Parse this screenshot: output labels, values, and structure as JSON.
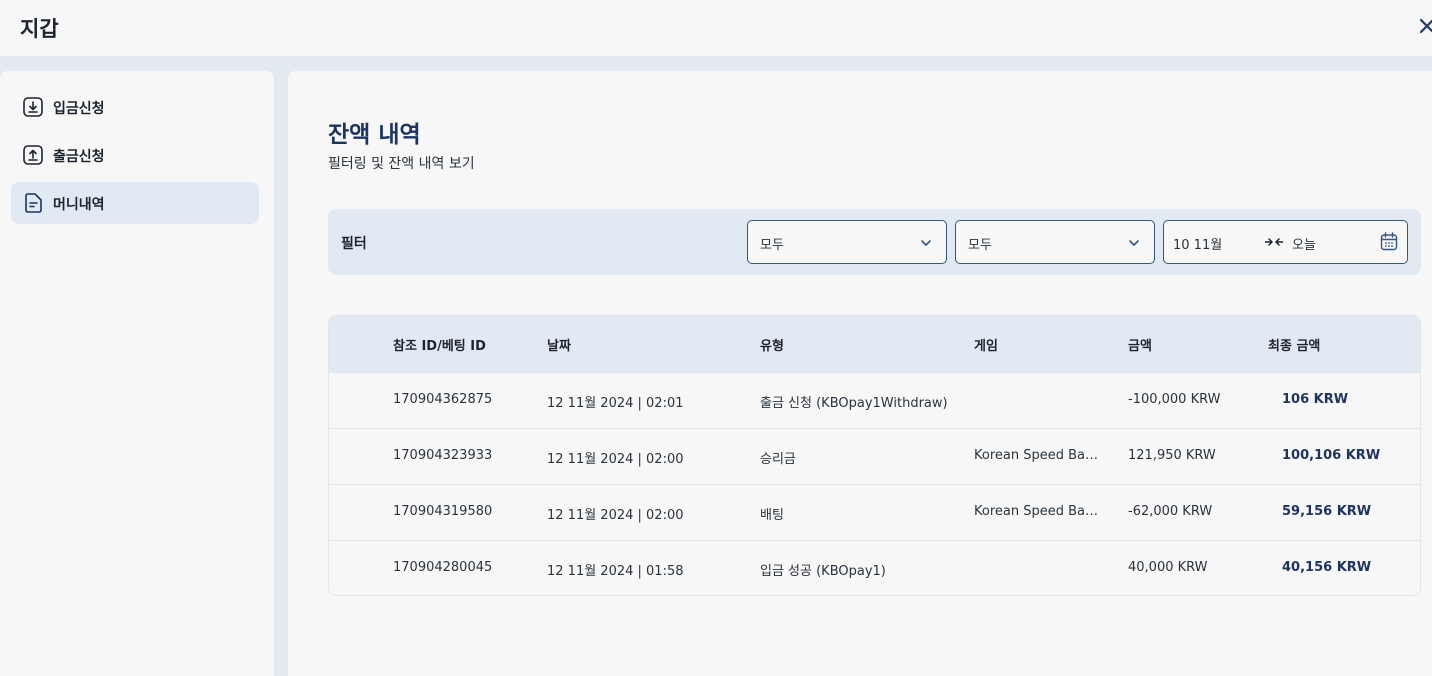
{
  "header": {
    "title": "지갑",
    "close_icon": "close-icon"
  },
  "sidebar": {
    "items": [
      {
        "label": "입금신청",
        "icon": "download-icon",
        "active": false
      },
      {
        "label": "출금신청",
        "icon": "upload-icon",
        "active": false
      },
      {
        "label": "머니내역",
        "icon": "document-icon",
        "active": true
      }
    ]
  },
  "main": {
    "title": "잔액 내역",
    "subtitle": "필터링 및 잔액 내역 보기",
    "filter": {
      "label": "필터",
      "select1": "모두",
      "select2": "모두",
      "date_from": "10 11월",
      "date_to": "오늘"
    },
    "table": {
      "headers": [
        "참조 ID/베팅 ID",
        "날짜",
        "유형",
        "게임",
        "금액",
        "최종 금액"
      ],
      "rows": [
        {
          "id": "170904362875",
          "date": "12 11월 2024 | 02:01",
          "type": "출금 신청 (KBOpay1Withdraw)",
          "game": "",
          "amount": "-100,000 KRW",
          "final": "106 KRW"
        },
        {
          "id": "170904323933",
          "date": "12 11월 2024 | 02:00",
          "type": "승리금",
          "game": "Korean Speed Baccarat",
          "amount": "121,950 KRW",
          "final": "100,106 KRW"
        },
        {
          "id": "170904319580",
          "date": "12 11월 2024 | 02:00",
          "type": "배팅",
          "game": "Korean Speed Baccarat",
          "amount": "-62,000 KRW",
          "final": "59,156 KRW"
        },
        {
          "id": "170904280045",
          "date": "12 11월 2024 | 01:58",
          "type": "입금 성공 (KBOpay1)",
          "game": "",
          "amount": "40,000 KRW",
          "final": "40,156 KRW"
        }
      ]
    }
  },
  "colors": {
    "accent": "#1d3461",
    "border": "#33577f",
    "panel": "#e1e9f2",
    "background": "#f7f7f7"
  }
}
